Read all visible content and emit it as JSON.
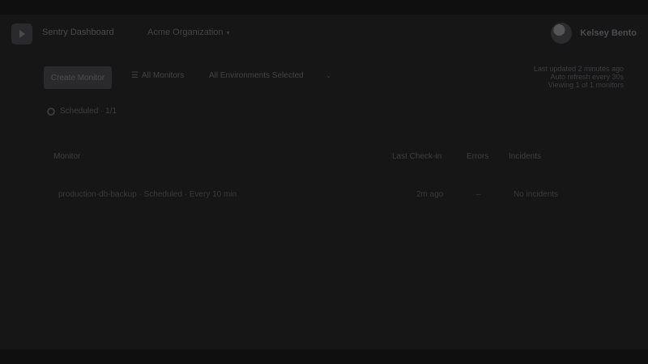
{
  "header": {
    "app_name": "Sentry Dashboard",
    "project_switcher": "Acme Organization",
    "project_caret": "▾",
    "user_name": "Kelsey Bento",
    "logo_icon": "play-box-icon"
  },
  "toolbar": {
    "primary_button": "Create Monitor",
    "filter_label": "All Monitors",
    "filter_icon": "filter-icon",
    "environment_select": "All Environments Selected",
    "environment_caret": "⌄",
    "meta_lines": [
      "Last updated 2 minutes ago",
      "Auto refresh every 30s",
      "Viewing 1 of 1 monitors"
    ]
  },
  "status": {
    "icon": "circle-status-icon",
    "label": "Scheduled · 1/1"
  },
  "table": {
    "headers": {
      "name": "Monitor",
      "latest": "Last Check-in",
      "errors": "Errors",
      "incidents": "Incidents"
    },
    "rows": [
      {
        "name": "production-db-backup · Scheduled · Every 10 min",
        "latest": "2m ago",
        "errors": "–",
        "incidents": "No incidents"
      }
    ]
  },
  "colors": {
    "background": "#0f0f10",
    "frame": "#161617",
    "button": "#2a2a2c",
    "text": "#444447"
  }
}
